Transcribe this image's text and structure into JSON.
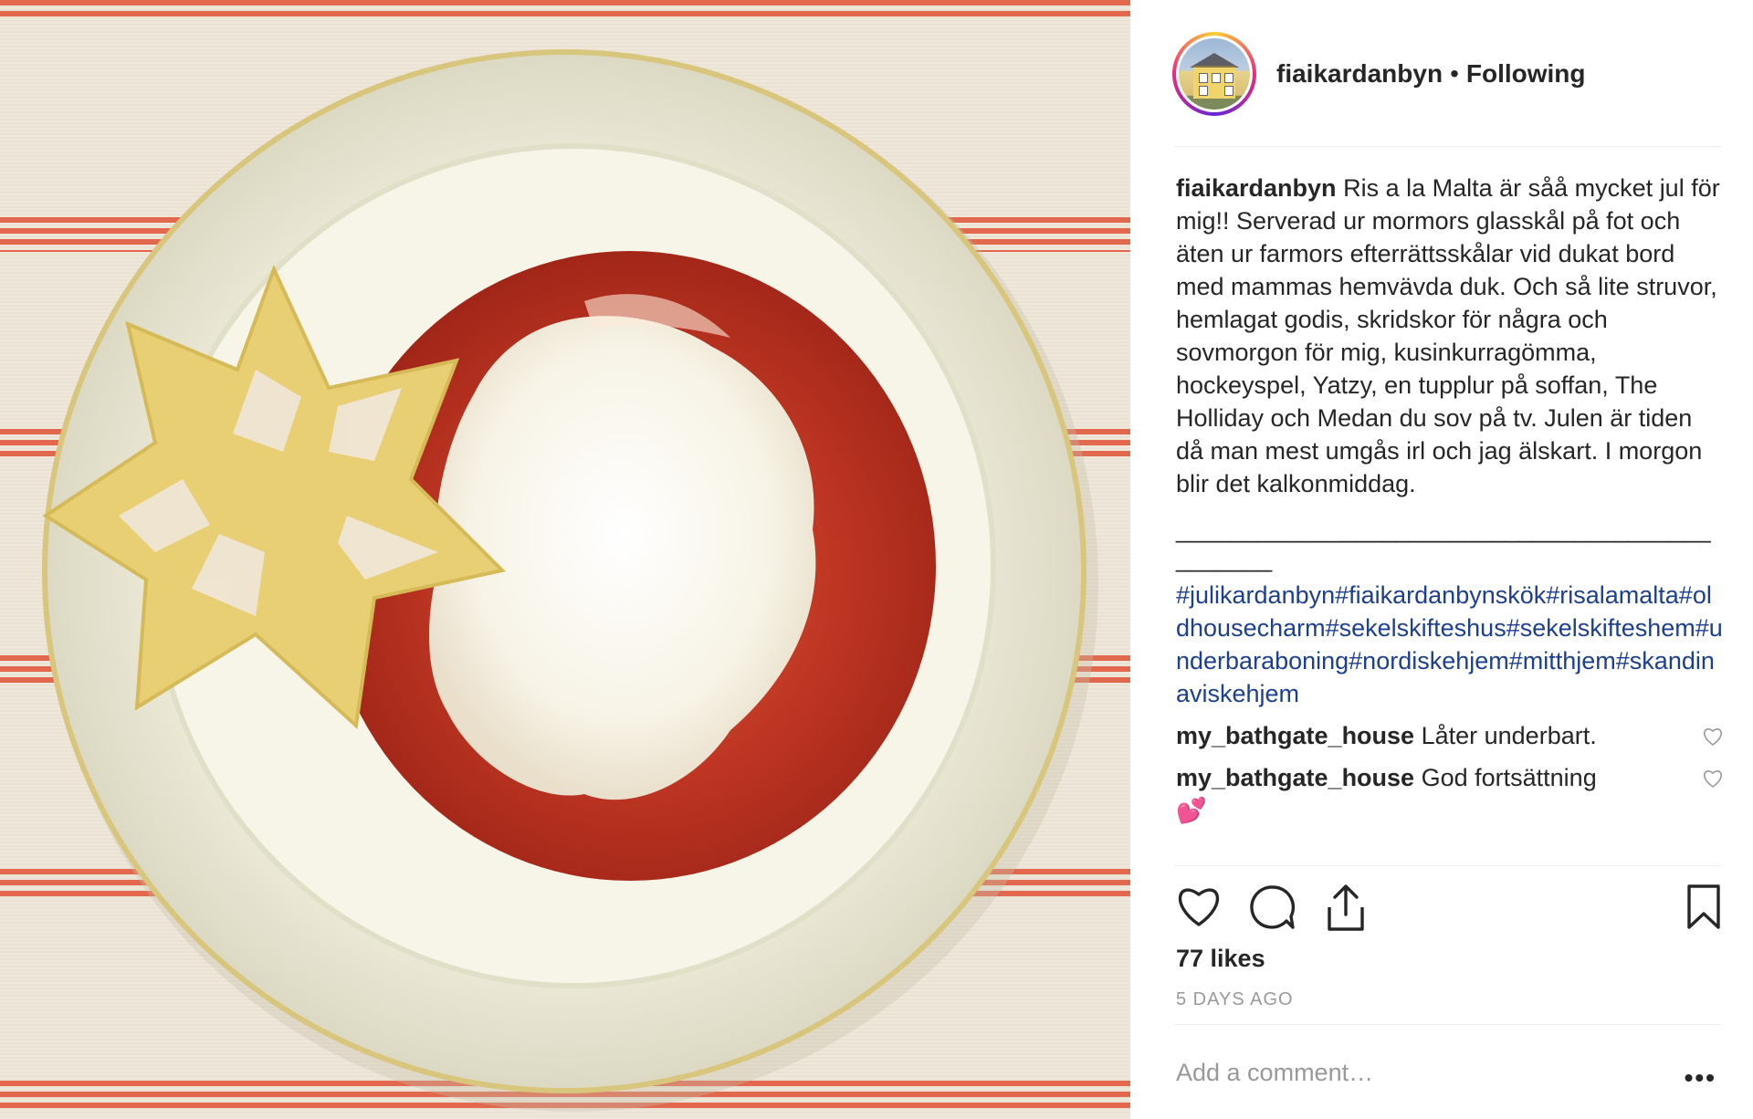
{
  "post": {
    "image_alt": "",
    "image_colors": {
      "tablecloth": "#efe7da",
      "stripe": "#e05a3e",
      "bowl": "#f4f3e4",
      "sauce": "#b8301f",
      "rice": "#fbf8ef",
      "cookie": "#e9d27a"
    }
  },
  "header": {
    "username": "fiaikardanbyn",
    "separator": "•",
    "follow_status": "Following"
  },
  "caption": {
    "username": "fiaikardanbyn",
    "text": "Ris a la Malta är såå mycket jul för mig!! Serverad ur mormors glasskål på fot och äten ur farmors efterrättsskålar vid dukat bord med mammas hemvävda duk. Och så lite struvor, hemlagat godis, skridskor för några och sovmorgon för mig, kusinkurragömma, hockeyspel, Yatzy, en tupplur på soffan, The Holliday och Medan du sov på tv. Julen är tiden då man mest umgås irl och jag älskart. I morgon blir det kalkonmiddag.",
    "dashes": "______________________________________________",
    "hashtags": "#julikardanbyn#fiaikardanbynskök#risalamalta#oldhousecharm#sekelskifteshus#sekelskifteshem#underbaraboning#nordiskehjem#mitthjem#skandinaviskehjem"
  },
  "comments": [
    {
      "username": "my_bathgate_house",
      "text": "Låter underbart."
    },
    {
      "username": "my_bathgate_house",
      "text": "God fortsättning",
      "emoji": "💕"
    }
  ],
  "actions": {
    "like_icon": "heart-icon",
    "comment_icon": "comment-icon",
    "share_icon": "share-icon",
    "save_icon": "bookmark-icon"
  },
  "likes": "77 likes",
  "time_ago": "5 DAYS AGO",
  "add_comment": {
    "placeholder": "Add a comment…"
  },
  "more": "•••",
  "colors": {
    "text": "#262626",
    "muted": "#999999",
    "hashtag": "#1d3f8f",
    "divider": "#efefef"
  }
}
